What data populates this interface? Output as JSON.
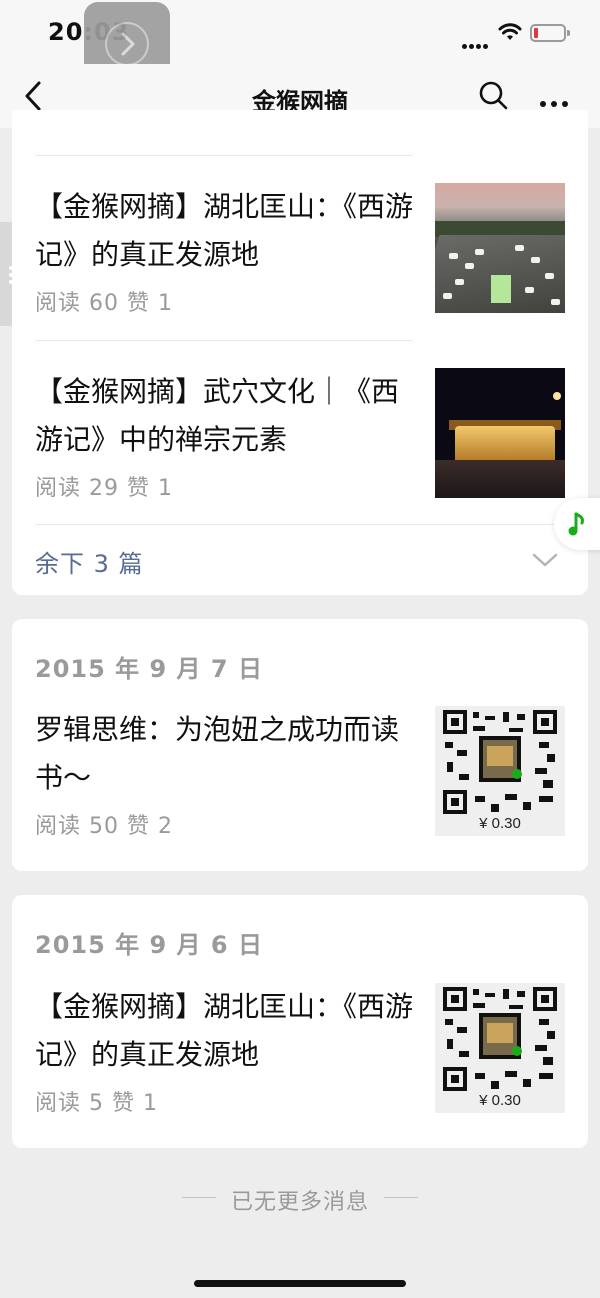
{
  "status_bar": {
    "time": "20:03"
  },
  "nav": {
    "title": "金猴网摘"
  },
  "cards": [
    {
      "articles": [
        {
          "title": "【金猴网摘】湖北匡山：《西游记》的真正发源地",
          "stats": "阅读 60  赞 1",
          "thumb": "highway-photo"
        },
        {
          "title": "【金猴网摘】武穴文化｜《西游记》中的禅宗元素",
          "stats": "阅读 29  赞 1",
          "thumb": "temple-night-photo"
        }
      ],
      "more_label": "余下 3 篇"
    },
    {
      "date": "2015 年 9 月 7 日",
      "articles": [
        {
          "title": "罗辑思维：为泡妞之成功而读书～",
          "stats": "阅读 50  赞 2",
          "thumb": "qr-code",
          "price": "¥ 0.30"
        }
      ]
    },
    {
      "date": "2015 年 9 月 6 日",
      "articles": [
        {
          "title": "【金猴网摘】湖北匡山：《西游记》的真正发源地",
          "stats": "阅读 5  赞 1",
          "thumb": "qr-code",
          "price": "¥ 0.30"
        }
      ]
    }
  ],
  "footer": {
    "end_text": "已无更多消息"
  },
  "colors": {
    "link": "#576b95",
    "muted": "#9a9a9a",
    "background": "#ededed",
    "music_icon": "#1aad19"
  }
}
